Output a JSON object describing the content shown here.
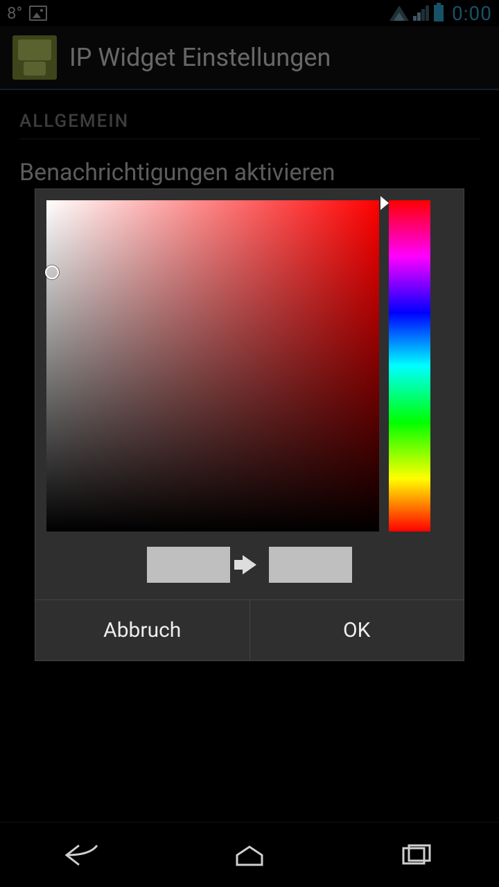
{
  "status_bar": {
    "temperature": "8°",
    "time": "0:00"
  },
  "action_bar": {
    "title": "IP Widget Einstellungen"
  },
  "settings": {
    "section_header": "ALLGEMEIN",
    "item1_title": "Benachrichtigungen aktivieren"
  },
  "color_picker": {
    "current_color": "#bfbfbf",
    "new_color": "#bfbfbf",
    "hue_position": 0,
    "sv_cursor": {
      "s": 0.0,
      "v": 0.8
    }
  },
  "dialog_buttons": {
    "cancel": "Abbruch",
    "ok": "OK"
  },
  "nav": {
    "back": "back",
    "home": "home",
    "recent": "recent"
  }
}
